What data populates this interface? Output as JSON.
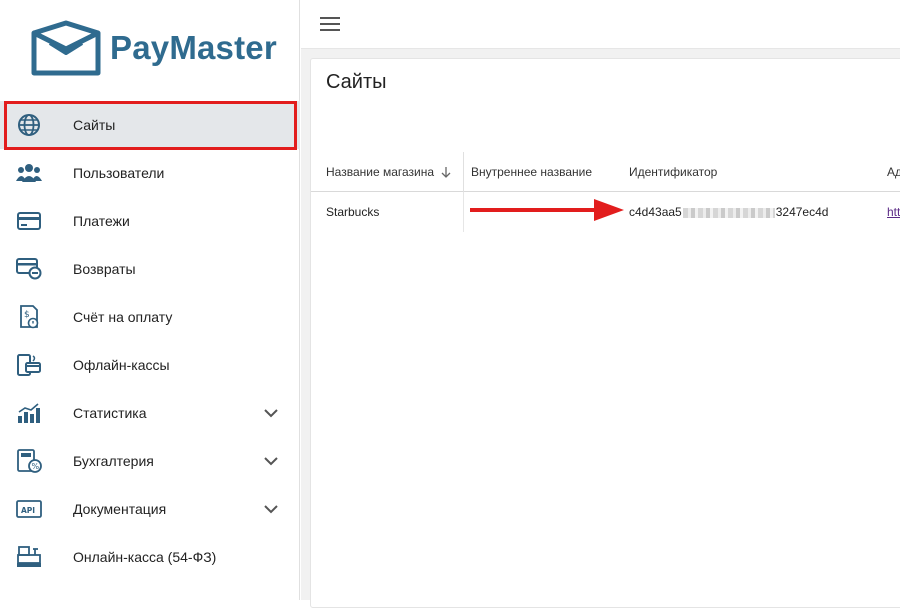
{
  "brand": {
    "name": "PayMaster",
    "color": "#2f6b8f"
  },
  "sidebar": {
    "items": [
      {
        "label": "Сайты",
        "icon": "globe-icon",
        "active": true
      },
      {
        "label": "Пользователи",
        "icon": "users-icon"
      },
      {
        "label": "Платежи",
        "icon": "credit-card-icon"
      },
      {
        "label": "Возвраты",
        "icon": "card-refund-icon"
      },
      {
        "label": "Счёт на оплату",
        "icon": "invoice-icon"
      },
      {
        "label": "Офлайн-кассы",
        "icon": "offline-terminal-icon"
      },
      {
        "label": "Статистика",
        "icon": "bar-chart-icon",
        "expandable": true
      },
      {
        "label": "Бухгалтерия",
        "icon": "calculator-percent-icon",
        "expandable": true
      },
      {
        "label": "Документация",
        "icon": "api-doc-icon",
        "expandable": true
      },
      {
        "label": "Онлайн-касса (54-ФЗ)",
        "icon": "cash-register-icon"
      }
    ]
  },
  "main": {
    "title": "Сайты",
    "table": {
      "columns": [
        "Название магазина",
        "Внутреннее название",
        "Идентификатор",
        "Ад"
      ],
      "rows": [
        {
          "name": "Starbucks",
          "internal": "",
          "id_prefix": "c4d43aa5",
          "id_suffix": "3247ec4d",
          "address": "htt"
        }
      ]
    }
  },
  "colors": {
    "highlight": "#e21d1d",
    "active_bg": "#e4e7ea",
    "link": "#5b2a86"
  }
}
